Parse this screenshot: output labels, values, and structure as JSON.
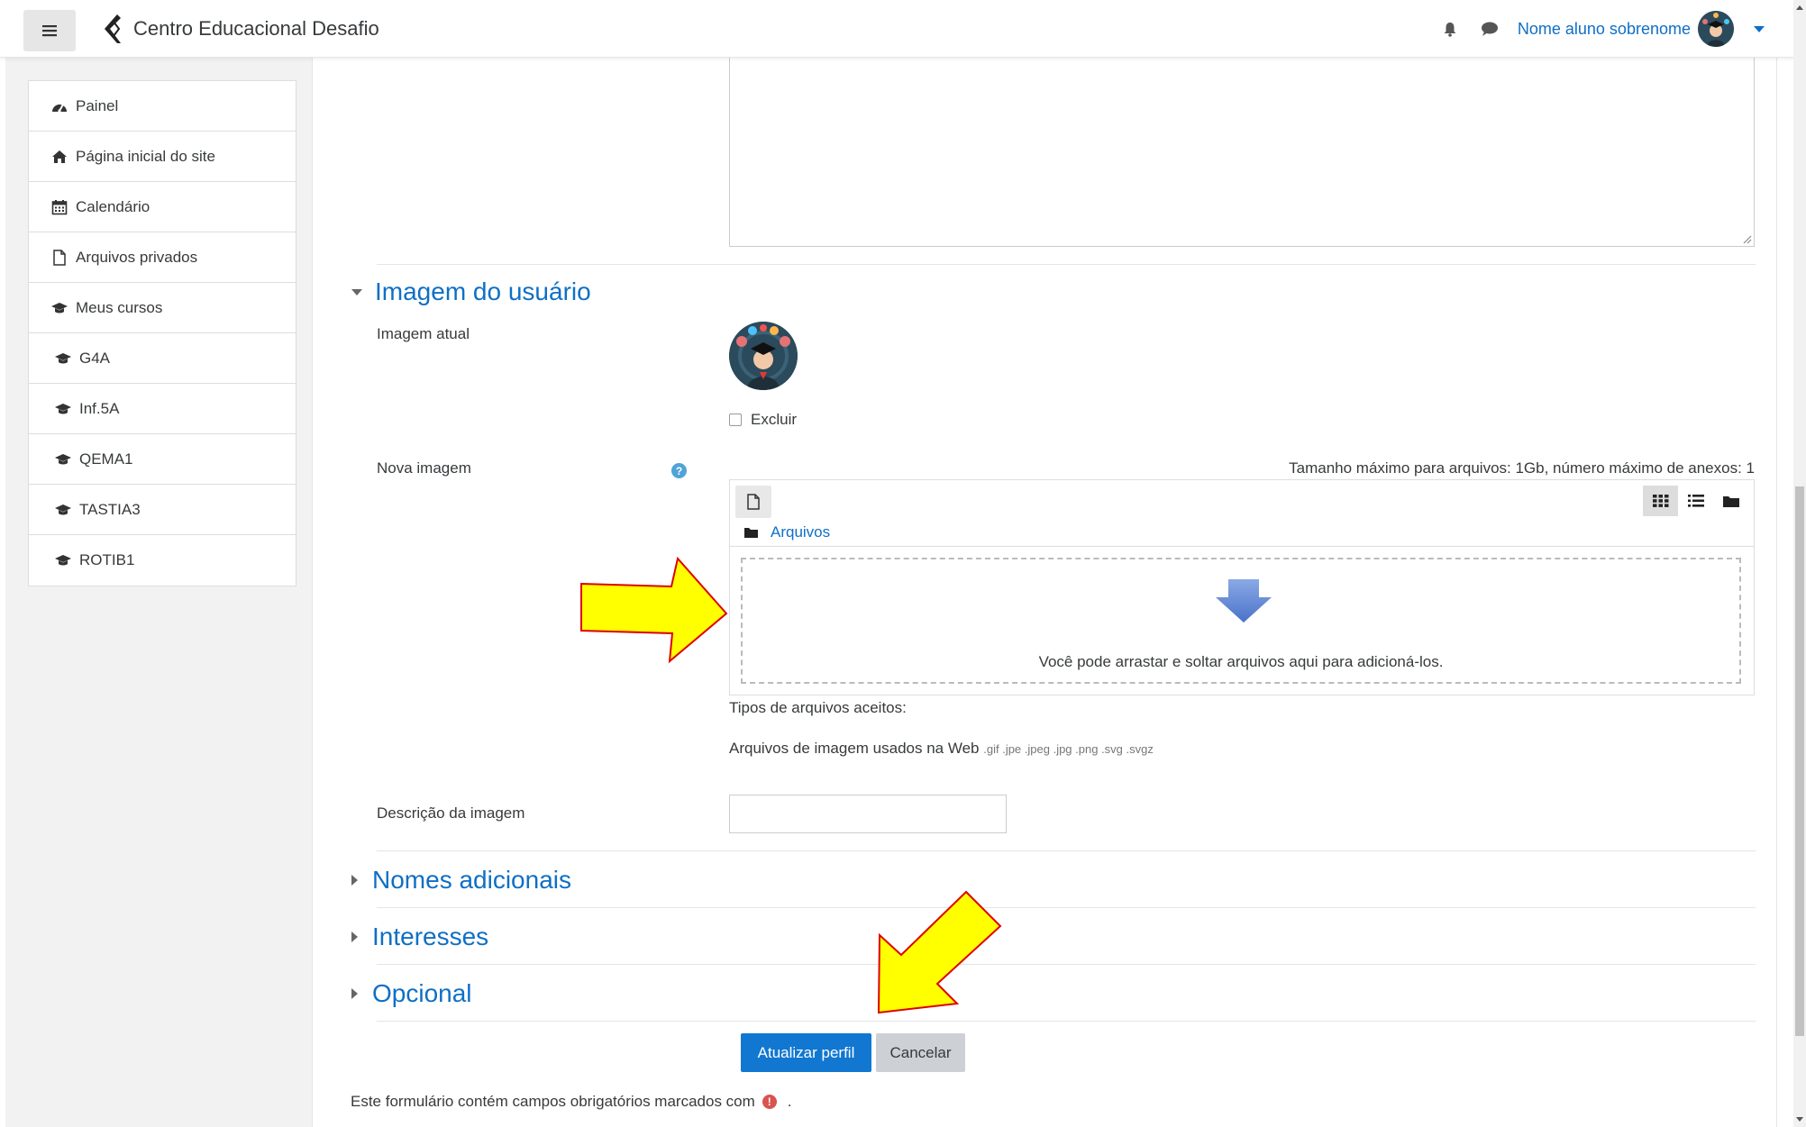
{
  "header": {
    "site_name": "Centro Educacional Desafio",
    "user_name": "Nome aluno sobrenome"
  },
  "sidebar": {
    "items": [
      {
        "label": "Painel",
        "icon": "dashboard-icon"
      },
      {
        "label": "Página inicial do site",
        "icon": "home-icon"
      },
      {
        "label": "Calendário",
        "icon": "calendar-icon"
      },
      {
        "label": "Arquivos privados",
        "icon": "file-icon"
      },
      {
        "label": "Meus cursos",
        "icon": "graduation-cap-icon"
      },
      {
        "label": "G4A",
        "icon": "graduation-cap-icon"
      },
      {
        "label": "Inf.5A",
        "icon": "graduation-cap-icon"
      },
      {
        "label": "QEMA1",
        "icon": "graduation-cap-icon"
      },
      {
        "label": "TASTIA3",
        "icon": "graduation-cap-icon"
      },
      {
        "label": "ROTIB1",
        "icon": "graduation-cap-icon"
      }
    ]
  },
  "form": {
    "user_image_section": "Imagem do usuário",
    "current_image_label": "Imagem atual",
    "delete_label": "Excluir",
    "new_image_label": "Nova imagem",
    "max_size_info": "Tamanho máximo para arquivos: 1Gb, número máximo de anexos: 1",
    "files_path": "Arquivos",
    "drop_text": "Você pode arrastar e soltar arquivos aqui para adicioná-los.",
    "accepted_types_label": "Tipos de arquivos aceitos:",
    "accepted_types_name": "Arquivos de imagem usados na Web",
    "accepted_types_ext": ".gif .jpe .jpeg .jpg .png .svg .svgz",
    "image_description_label": "Descrição da imagem",
    "image_description_value": "",
    "section_additional_names": "Nomes adicionais",
    "section_interests": "Interesses",
    "section_optional": "Opcional",
    "submit_label": "Atualizar perfil",
    "cancel_label": "Cancelar",
    "required_note": "Este formulário contém campos obrigatórios marcados com",
    "required_note_end": "."
  },
  "colors": {
    "link": "#0f6fc5",
    "primary_button": "#1177d1",
    "annotation_arrow": "#ffff00",
    "annotation_outline": "#e00000"
  }
}
